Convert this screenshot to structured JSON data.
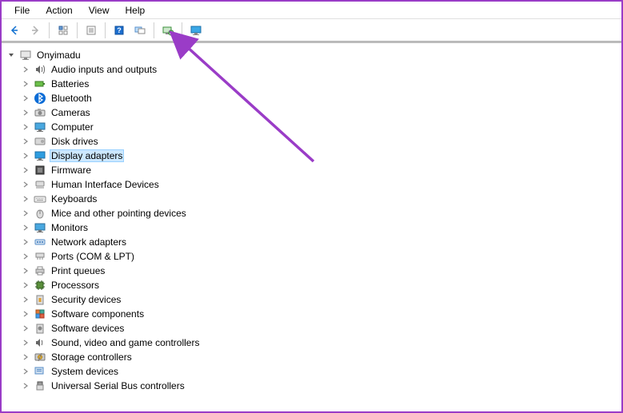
{
  "menu": {
    "file": "File",
    "action": "Action",
    "view": "View",
    "help": "Help"
  },
  "toolbar": {
    "back": "back-icon",
    "forward": "forward-icon",
    "up": "show-connect-icon",
    "properties": "properties-icon",
    "help": "help-icon",
    "show_hidden": "show-hidden-icon",
    "scan": "scan-hardware-icon",
    "monitor": "monitor-action-icon"
  },
  "tree": {
    "root": "Onyimadu",
    "items": [
      {
        "label": "Audio inputs and outputs",
        "icon": "speaker-icon"
      },
      {
        "label": "Batteries",
        "icon": "battery-icon"
      },
      {
        "label": "Bluetooth",
        "icon": "bluetooth-icon"
      },
      {
        "label": "Cameras",
        "icon": "camera-icon"
      },
      {
        "label": "Computer",
        "icon": "monitor-icon"
      },
      {
        "label": "Disk drives",
        "icon": "disk-icon"
      },
      {
        "label": "Display adapters",
        "icon": "display-adapter-icon",
        "selected": true
      },
      {
        "label": "Firmware",
        "icon": "firmware-icon"
      },
      {
        "label": "Human Interface Devices",
        "icon": "hid-icon"
      },
      {
        "label": "Keyboards",
        "icon": "keyboard-icon"
      },
      {
        "label": "Mice and other pointing devices",
        "icon": "mouse-icon"
      },
      {
        "label": "Monitors",
        "icon": "monitor-icon"
      },
      {
        "label": "Network adapters",
        "icon": "network-icon"
      },
      {
        "label": "Ports (COM & LPT)",
        "icon": "port-icon"
      },
      {
        "label": "Print queues",
        "icon": "printer-icon"
      },
      {
        "label": "Processors",
        "icon": "cpu-icon"
      },
      {
        "label": "Security devices",
        "icon": "security-icon"
      },
      {
        "label": "Software components",
        "icon": "software-component-icon"
      },
      {
        "label": "Software devices",
        "icon": "software-device-icon"
      },
      {
        "label": "Sound, video and game controllers",
        "icon": "sound-icon"
      },
      {
        "label": "Storage controllers",
        "icon": "storage-icon"
      },
      {
        "label": "System devices",
        "icon": "system-icon"
      },
      {
        "label": "Universal Serial Bus controllers",
        "icon": "usb-icon"
      }
    ]
  },
  "annotation_color": "#9a3cc7"
}
